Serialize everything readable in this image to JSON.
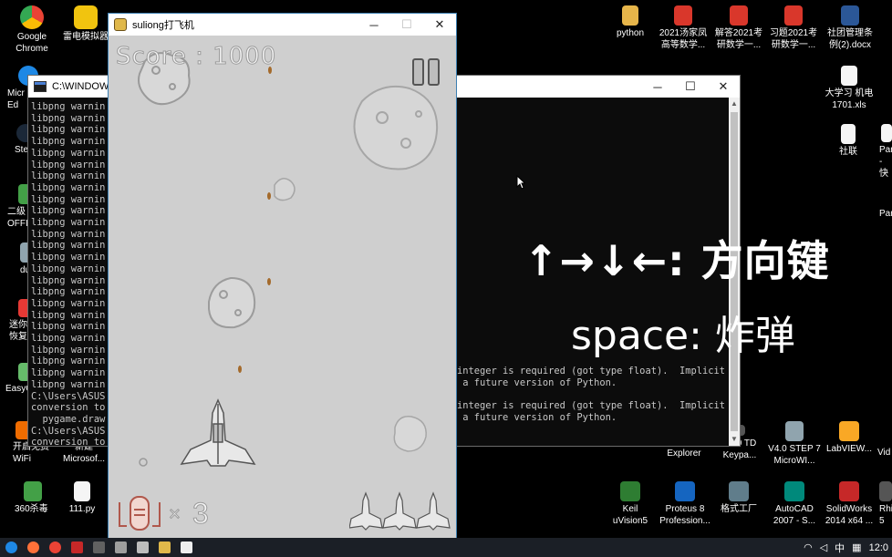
{
  "desktop_left": [
    {
      "label": "Google\nChrome",
      "color": "#e44d3a"
    },
    {
      "label": "雷电模拟器",
      "color": "#f1c40f"
    }
  ],
  "desktop_left_partial": [
    {
      "label": "Micr\nEd"
    },
    {
      "label": "Ste"
    },
    {
      "label": "二级\nOFFIC"
    },
    {
      "label": "du"
    },
    {
      "label": "迷你\n恢复"
    },
    {
      "label": "EasyC"
    },
    {
      "label": "开启免费\nWiFi"
    },
    {
      "label": "新建\nMicrosof..."
    },
    {
      "label": "360杀毒"
    },
    {
      "label": "111.py"
    }
  ],
  "desktop_top_right": [
    {
      "label": "python",
      "color": "#e6b54a"
    },
    {
      "label": "2021汤家凤\n高等数学...",
      "color": "#d9372b"
    },
    {
      "label": "解答2021考\n研数学一...",
      "color": "#d9372b"
    },
    {
      "label": "习题2021考\n研数学一...",
      "color": "#d9372b"
    },
    {
      "label": "社团管理条\n例(2).docx",
      "color": "#2b5797"
    }
  ],
  "desktop_right_col": [
    {
      "label": "大学习 机电\n1701.xls"
    },
    {
      "label": "社联"
    },
    {
      "label": "Par\n- 快"
    },
    {
      "label": "Par"
    }
  ],
  "desktop_bottom_right_row1": [
    {
      "label": "V2.0 S7-200\nExplorer"
    },
    {
      "label": "V1.0 TD\nKeypa..."
    },
    {
      "label": "V4.0 STEP 7\nMicroWI..."
    },
    {
      "label": "LabVIEW..."
    },
    {
      "label": "Vid"
    }
  ],
  "desktop_bottom_right_row2": [
    {
      "label": "Keil\nuVision5",
      "color": "#2e7d32"
    },
    {
      "label": "Proteus 8\nProfession...",
      "color": "#1565c0"
    },
    {
      "label": "格式工厂",
      "color": "#607d8b"
    },
    {
      "label": "AutoCAD\n2007 - S...",
      "color": "#00897b"
    },
    {
      "label": "SolidWorks\n2014 x64 ...",
      "color": "#c62828"
    },
    {
      "label": "Rhi\n5",
      "color": "#555555"
    }
  ],
  "console": {
    "title": "C:\\WINDOWS",
    "lines": [
      "libpng warnin",
      "libpng warnin",
      "libpng warnin",
      "libpng warnin",
      "libpng warnin",
      "libpng warnin",
      "libpng warnin",
      "libpng warnin",
      "libpng warnin",
      "libpng warnin",
      "libpng warnin",
      "libpng warnin",
      "libpng warnin",
      "libpng warnin",
      "libpng warnin",
      "libpng warnin",
      "libpng warnin",
      "libpng warnin",
      "libpng warnin",
      "libpng warnin",
      "libpng warnin",
      "libpng warnin",
      "libpng warnin",
      "libpng warnin",
      "libpng warnin",
      "C:\\Users\\ASUS",
      "conversion to",
      "  pygame.draw",
      "C:\\Users\\ASUS",
      "conversion to",
      "  pygame.draw"
    ],
    "right_lines": [
      "integer is required (got type float).  Implicit",
      " a future version of Python.",
      "",
      "integer is required (got type float).  Implicit",
      " a future version of Python."
    ],
    "controls": [
      "─",
      "☐",
      "✕"
    ]
  },
  "hints": {
    "arrows": "↑→↓←: 方向键",
    "space": "space: 炸弹"
  },
  "game": {
    "title": "suliong打飞机",
    "score_label": "Score : 1000",
    "lives_x": "×",
    "lives_count": "3",
    "controls": [
      "─",
      "☐",
      "✕"
    ]
  },
  "taskbar": {
    "tray_lang": "中",
    "tray_time": "12:0"
  },
  "colors": {
    "game_bg": "#cfcfcf",
    "console_bg": "#0c0c0c",
    "taskbar_bg": "#1b1f26"
  }
}
